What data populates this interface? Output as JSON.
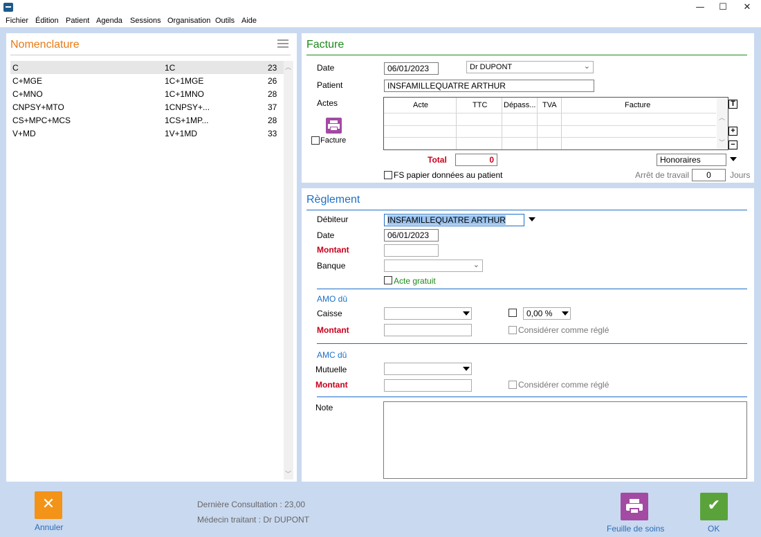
{
  "window": {
    "minimize": "—",
    "maximize": "☐",
    "close": "✕"
  },
  "menu": [
    "Fichier",
    "Édition",
    "Patient",
    "Agenda",
    "Sessions",
    "Organisation",
    "Outils",
    "Aide"
  ],
  "nomenclature": {
    "title": "Nomenclature",
    "rows": [
      {
        "name": "C",
        "code": "1C",
        "value": "23"
      },
      {
        "name": "C+MGE",
        "code": "1C+1MGE",
        "value": "26"
      },
      {
        "name": "C+MNO",
        "code": "1C+1MNO",
        "value": "28"
      },
      {
        "name": "CNPSY+MTO",
        "code": "1CNPSY+...",
        "value": "37"
      },
      {
        "name": "CS+MPC+MCS",
        "code": "1CS+1MP...",
        "value": "28"
      },
      {
        "name": "V+MD",
        "code": "1V+1MD",
        "value": "33"
      }
    ]
  },
  "facture": {
    "title": "Facture",
    "date_label": "Date",
    "date_value": "06/01/2023",
    "doctor_value": "Dr DUPONT",
    "patient_label": "Patient",
    "patient_value": "INSFAMILLEQUATRE ARTHUR",
    "actes_label": "Actes",
    "columns": [
      "Acte",
      "TTC",
      "Dépass...",
      "TVA",
      "Facture"
    ],
    "facture_checkbox": "Facture",
    "total_label": "Total",
    "total_value": "0",
    "honoraires_value": "Honoraires",
    "fs_checkbox": "FS papier données au patient",
    "arret_label": "Arrêt de travail",
    "arret_value": "0",
    "jours_label": "Jours",
    "t_button": "T",
    "plus_button": "+",
    "minus_button": "−"
  },
  "reglement": {
    "title": "Règlement",
    "debiteur_label": "Débiteur",
    "debiteur_value": "INSFAMILLEQUATRE ARTHUR",
    "date_label": "Date",
    "date_value": "06/01/2023",
    "montant_label": "Montant",
    "banque_label": "Banque",
    "acte_gratuit": "Acte gratuit",
    "amo_title": "AMO dû",
    "caisse_label": "Caisse",
    "amo_percent": "0,00 %",
    "amo_montant_label": "Montant",
    "amo_consider": "Considérer comme réglé",
    "amc_title": "AMC dû",
    "mutuelle_label": "Mutuelle",
    "amc_montant_label": "Montant",
    "amc_consider": "Considérer comme réglé",
    "note_label": "Note"
  },
  "footer": {
    "annuler": "Annuler",
    "derniere_consultation": "Dernière Consultation : 23,00",
    "medecin_traitant": "Médecin traitant : Dr DUPONT",
    "feuille_de_soins": "Feuille de soins",
    "ok": "OK"
  },
  "colors": {
    "facture_green": "#1a8a1a",
    "reglement_blue": "#1b6fc7",
    "nomenclature_orange": "#e87a14",
    "annuler_orange": "#f39317",
    "feuille_purple": "#a34aa3",
    "ok_green": "#5aa33a"
  }
}
